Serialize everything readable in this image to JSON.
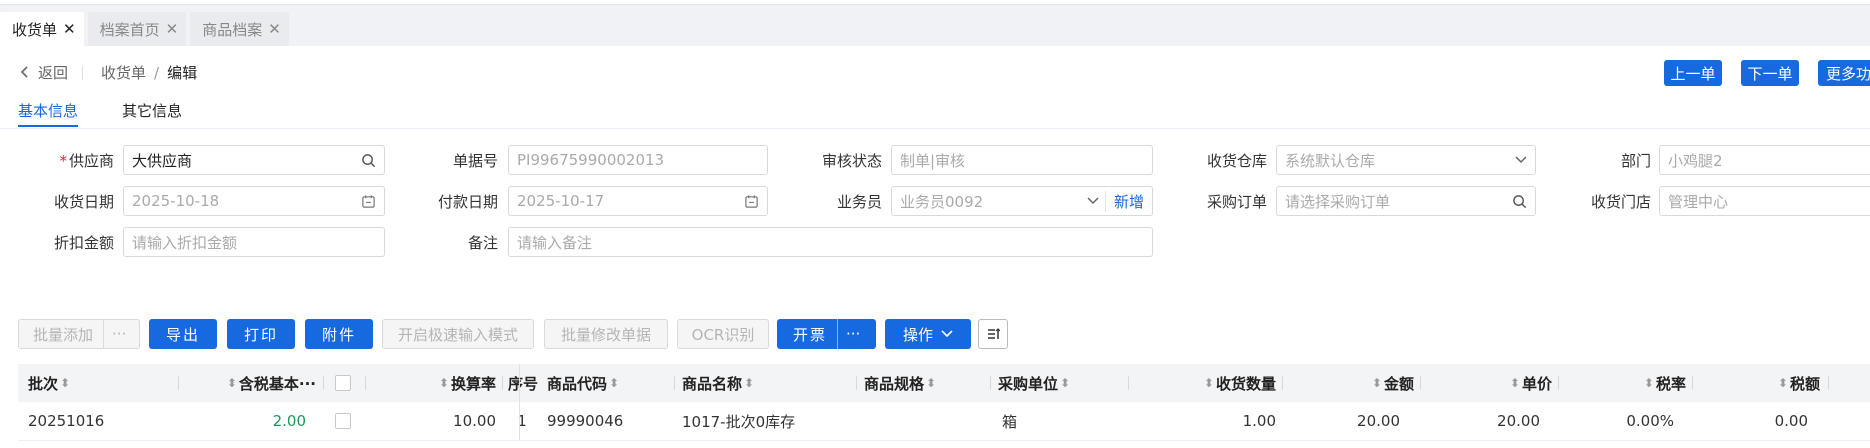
{
  "tabs": [
    {
      "label": "收货单",
      "close": "✕"
    },
    {
      "label": "档案首页",
      "close": "✕"
    },
    {
      "label": "商品档案",
      "close": "✕"
    }
  ],
  "breadcrumb": {
    "back": "返回",
    "parent": "收货单",
    "separator": "/",
    "current": "编辑"
  },
  "top_buttons": {
    "prev": "上一单",
    "next": "下一单",
    "more": "更多功"
  },
  "sub_tabs": [
    "基本信息",
    "其它信息"
  ],
  "form": {
    "supplier": {
      "required_mark": "*",
      "label": "供应商",
      "value": "大供应商"
    },
    "doc_no": {
      "label": "单据号",
      "value": "PI99675990002013"
    },
    "audit_status": {
      "label": "审核状态",
      "placeholder": "制单|审核"
    },
    "warehouse": {
      "label": "收货仓库",
      "placeholder": "系统默认仓库"
    },
    "department": {
      "label": "部门",
      "placeholder": "小鸡腿2"
    },
    "receive_date": {
      "label": "收货日期",
      "value": "2025-10-18"
    },
    "pay_date": {
      "label": "付款日期",
      "value": "2025-10-17"
    },
    "salesman": {
      "label": "业务员",
      "placeholder": "业务员0092",
      "add": "新增"
    },
    "purchase_order": {
      "label": "采购订单",
      "placeholder": "请选择采购订单"
    },
    "store": {
      "label": "收货门店",
      "placeholder": "管理中心"
    },
    "discount": {
      "label": "折扣金额",
      "placeholder": "请输入折扣金额"
    },
    "remark": {
      "label": "备注",
      "placeholder": "请输入备注"
    }
  },
  "toolbar": {
    "batch_add": "批量添加",
    "more_dots": "···",
    "export": "导出",
    "print": "打印",
    "attach": "附件",
    "fast_mode": "开启极速输入模式",
    "batch_edit": "批量修改单据",
    "ocr": "OCR识别",
    "invoice": "开票",
    "operate": "操作"
  },
  "table": {
    "headers": {
      "batch": "批次",
      "tax_price": "含税基本···",
      "rate": "换算率",
      "seq": "序号",
      "code": "商品代码",
      "name": "商品名称",
      "spec": "商品规格",
      "unit": "采购单位",
      "qty": "收货数量",
      "amount": "金额",
      "price": "单价",
      "tax_rate": "税率",
      "tax": "税额"
    },
    "rows": [
      {
        "batch": "20251016",
        "tax_price": "2.00",
        "rate": "10.00",
        "seq": "1",
        "code": "99990046",
        "name": "1017-批次0库存",
        "spec": "",
        "unit": "箱",
        "qty": "1.00",
        "amount": "20.00",
        "price": "20.00",
        "tax_rate": "0.00%",
        "tax": "0.00"
      }
    ]
  },
  "icons": [
    "close-icon",
    "back-arrow-icon",
    "search-icon",
    "calendar-icon",
    "chevron-down-icon",
    "sort-icon",
    "column-settings-icon"
  ],
  "colors": {
    "primary": "#1769e0",
    "positive": "#1a9a5a",
    "required": "#e23333"
  }
}
